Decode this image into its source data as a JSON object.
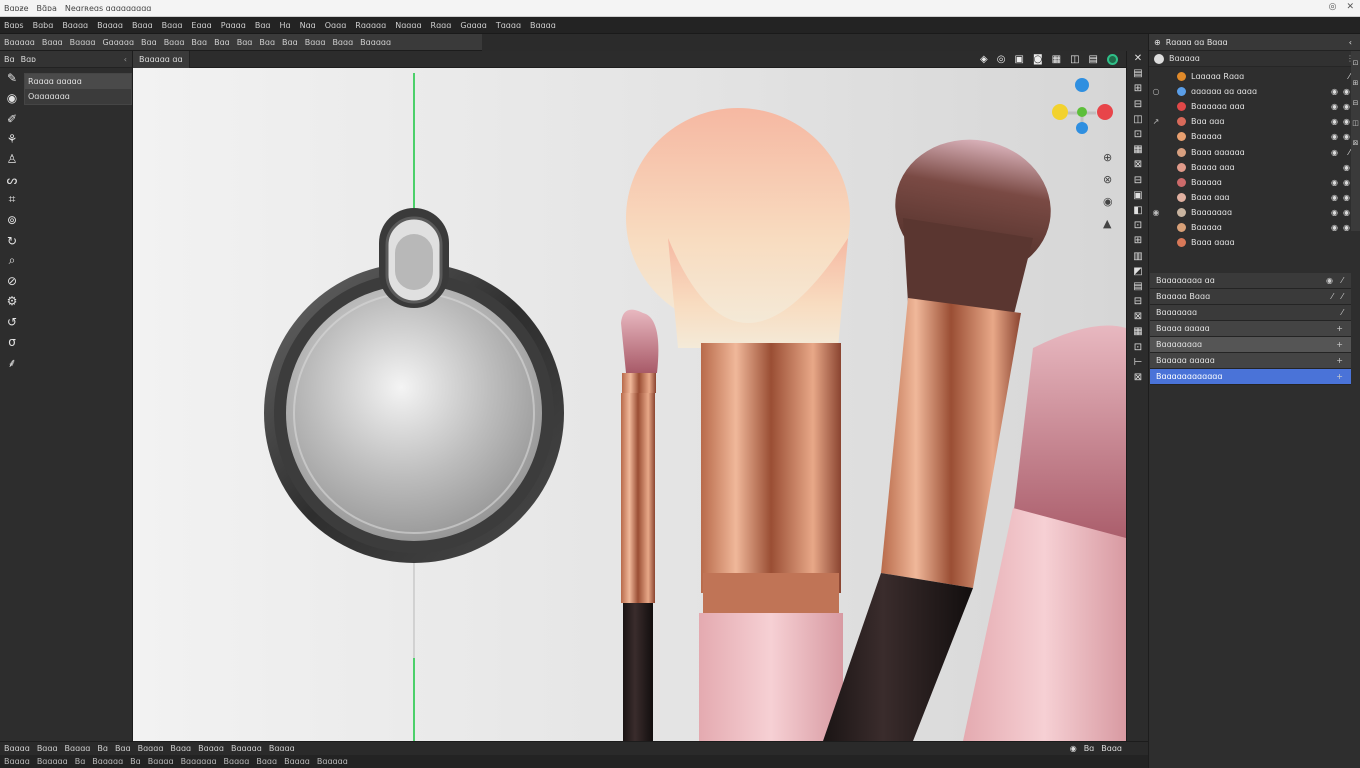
{
  "window": {
    "title_words": [
      "Bɑᴅƶe",
      "Bɑ̃ᴅa",
      "Neɑrʀeɑs ɑɑɑɑɑɑɑɑɑ"
    ],
    "controls": [
      "◎",
      "✕"
    ]
  },
  "menubar": {
    "items": [
      "Bɑᴅs",
      "Bɑbɑ",
      "Bɑɑɑɑ",
      "Bɑɑɑɑ",
      "Bɑɑɑ",
      "Bɑɑɑ",
      "Eɑɑɑ",
      "Pɑɑɑɑ",
      "Bɑɑ",
      "Hɑ",
      "Nɑɑ",
      "Oɑɑɑ",
      "Rɑɑɑɑɑ",
      "Nɑɑɑɑ",
      "Rɑɑɑ",
      "Gɑɑɑɑ",
      "Tɑɑɑɑ",
      "Bɑɑɑɑ"
    ]
  },
  "toolbar": {
    "items": [
      "Bɑɑɑɑɑ",
      "Bɑɑɑ",
      "Bɑɑɑɑ",
      "Gɑɑɑɑɑ",
      "Bɑɑ",
      "Bɑɑɑ",
      "Bɑɑ",
      "Bɑɑ",
      "Bɑɑ",
      "Bɑɑ",
      "Bɑɑ",
      "Bɑɑɑ",
      "Bɑɑɑ",
      "Bɑɑɑɑɑ"
    ]
  },
  "left_panel": {
    "header_tabs": [
      "Bɑ",
      "Bɑᴅ"
    ],
    "chevron": "‹",
    "list": [
      "Rɑɑɑɑ ɑɑɑɑɑ",
      "Oɑɑɑɑɑɑɑ"
    ],
    "tools": [
      {
        "icon": "brush-tool-icon",
        "glyph": "✎"
      },
      {
        "icon": "sphere-tool-icon",
        "glyph": "◉"
      },
      {
        "icon": "pencil-tool-icon",
        "glyph": "✐"
      },
      {
        "icon": "clone-stamp-icon",
        "glyph": "⚘"
      },
      {
        "icon": "stamp-tool-icon",
        "glyph": "♙"
      },
      {
        "icon": "lasso-tool-icon",
        "glyph": "ᔕ"
      },
      {
        "icon": "crop-tool-icon",
        "glyph": "⌗"
      },
      {
        "icon": "smudge-tool-icon",
        "glyph": "⊚"
      },
      {
        "icon": "rotate-tool-icon",
        "glyph": "↻"
      },
      {
        "icon": "search-tool-icon",
        "glyph": "⌕"
      },
      {
        "icon": "eraser-tool-icon",
        "glyph": "⊘"
      },
      {
        "icon": "settings-tool-icon",
        "glyph": "⚙"
      },
      {
        "icon": "cycle-tool-icon",
        "glyph": "↺"
      },
      {
        "icon": "orbit-tool-icon",
        "glyph": "σ"
      },
      {
        "icon": "curve-tool-icon",
        "glyph": "⸙"
      }
    ]
  },
  "viewport": {
    "tab": "Bɑɑɑɑɑ ɑɑ",
    "icons": [
      {
        "name": "view-icon",
        "glyph": "◈"
      },
      {
        "name": "snap-icon",
        "glyph": "◎"
      },
      {
        "name": "grid-icon",
        "glyph": "▣"
      },
      {
        "name": "camera-icon",
        "glyph": "◙"
      },
      {
        "name": "shading-icon",
        "glyph": "▦"
      },
      {
        "name": "wire-icon",
        "glyph": "◫"
      },
      {
        "name": "display-icon",
        "glyph": "▤"
      }
    ],
    "nav_icons": [
      {
        "name": "zoom-icon",
        "glyph": "⊕"
      },
      {
        "name": "pan-icon",
        "glyph": "⊗"
      },
      {
        "name": "record-icon",
        "glyph": "◉"
      },
      {
        "name": "pointer-icon",
        "glyph": "▲"
      }
    ],
    "gizmo_colors": {
      "x": "#e8454a",
      "y": "#5dbf3a",
      "z": "#2f8fe0",
      "w": "#f2d22e"
    }
  },
  "right_tools": [
    "✕",
    "▤",
    "⊞",
    "⊟",
    "◫",
    "⊡",
    "▦",
    "⊠",
    "⊟",
    "▣",
    "◧",
    "⊡",
    "⊞",
    "▥",
    "◩",
    "▤",
    "⊟",
    "⊠",
    "▦",
    "⊡",
    "⊢",
    "⊠"
  ],
  "right_panel": {
    "header": "Rɑɑɑɑ ɑɑ Bɑɑɑ",
    "close": "‹",
    "more": "⋮",
    "search_label": "Bɑɑɑɑɑ",
    "search_right": "⁄",
    "layers": [
      {
        "label": "Lɑɑɑɑɑ Rɑɑɑ",
        "color": "#e08a2a",
        "twirl": "",
        "e1": "",
        "e2": "⁄"
      },
      {
        "label": "ɑɑɑɑɑɑ ɑɑ ɑɑɑɑ",
        "color": "#5a9ee8",
        "twirl": "○",
        "e1": "◉",
        "e2": "◉"
      },
      {
        "label": "Bɑɑɑɑɑɑ ɑɑɑ",
        "color": "#e04848",
        "twirl": "",
        "e1": "◉",
        "e2": "◉"
      },
      {
        "label": "Bɑɑ ɑɑɑ",
        "color": "#d86a5a",
        "twirl": "↗",
        "e1": "◉",
        "e2": "◉"
      },
      {
        "label": "Bɑɑɑɑɑ",
        "color": "#e8a070",
        "twirl": "",
        "e1": "◉",
        "e2": "◉"
      },
      {
        "label": "Bɑɑɑ ɑɑɑɑɑɑ",
        "color": "#d8a080",
        "twirl": "",
        "e1": "◉",
        "e2": "⁄"
      },
      {
        "label": "Bɑɑɑɑ ɑɑɑ",
        "color": "#e09a8a",
        "twirl": "",
        "e1": "",
        "e2": "◉"
      },
      {
        "label": "Bɑɑɑɑɑ",
        "color": "#cc6a6a",
        "twirl": "",
        "e1": "◉",
        "e2": "◉"
      },
      {
        "label": "Bɑɑɑ ɑɑɑ",
        "color": "#e0b0a0",
        "twirl": "",
        "e1": "◉",
        "e2": "◉"
      },
      {
        "label": "Bɑɑɑɑɑɑɑ",
        "color": "#c8b4a0",
        "twirl": "◉",
        "e1": "◉",
        "e2": "◉"
      },
      {
        "label": "Bɑɑɑɑɑ",
        "color": "#d8a078",
        "twirl": "",
        "e1": "◉",
        "e2": "◉"
      },
      {
        "label": "Bɑɑɑ ɑɑɑɑ",
        "color": "#d87858",
        "twirl": "",
        "e1": "",
        "e2": ""
      }
    ],
    "properties": [
      {
        "label": "Bɑɑɑɑɑɑɑɑ ɑɑ",
        "style": "a",
        "p1": "◉",
        "p2": "⁄"
      },
      {
        "label": "Bɑɑɑɑɑ Bɑɑɑ",
        "style": "a",
        "p1": "⁄",
        "p2": "⁄"
      },
      {
        "label": "Bɑɑɑɑɑɑɑ",
        "style": "a",
        "p1": "",
        "p2": "⁄"
      },
      {
        "label": "Bɑɑɑɑ ɑɑɑɑɑ",
        "style": "b",
        "p1": "",
        "p2": "+"
      },
      {
        "label": "Bɑɑɑɑɑɑɑɑ",
        "style": "c",
        "p1": "",
        "p2": "+"
      },
      {
        "label": "Bɑɑɑɑɑ ɑɑɑɑɑ",
        "style": "b",
        "p1": "",
        "p2": "+"
      },
      {
        "label": "Bɑɑɑɑɑɑɑɑɑɑɑɑ",
        "style": "sel",
        "p1": "",
        "p2": "+"
      }
    ],
    "scroll_icons": [
      "⊡",
      "⊞",
      "⊟",
      "◫",
      "⊠"
    ]
  },
  "statusbar": {
    "left": [
      "Bɑɑɑɑ",
      "Bɑɑɑ",
      "Bɑɑɑɑ",
      "Bɑ",
      "Bɑɑ",
      "Bɑɑɑɑ",
      "Bɑɑɑ",
      "Bɑɑɑɑ",
      "Bɑɑɑɑɑ",
      "Bɑɑɑɑ"
    ],
    "right": [
      "◉",
      "Bɑ",
      "Bɑɑɑ"
    ],
    "bottom": [
      "Bɑɑɑɑ",
      "Bɑɑɑɑɑ",
      "Bɑ",
      "Bɑɑɑɑɑ",
      "Bɑ",
      "Bɑɑɑɑ",
      "Bɑɑɑɑɑɑ",
      "Bɑɑɑɑ",
      "Bɑɑɑ",
      "Bɑɑɑɑ",
      "Bɑɑɑɑɑ"
    ]
  }
}
